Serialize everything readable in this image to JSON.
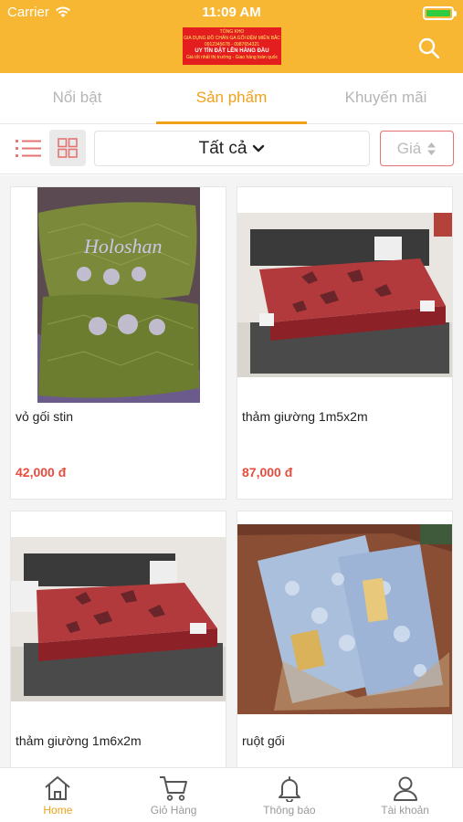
{
  "status_bar": {
    "carrier": "Carrier",
    "time": "11:09 AM",
    "battery_level": 1.0
  },
  "header": {
    "logo_lines": [
      "TỔNG KHO",
      "GIA DỤNG ĐỒ CHĂN GA GỐI ĐỆM MIỀN BẮC",
      "0912345678 - 0987654321",
      "UY TÍN ĐẶT LÊN HÀNG ĐẦU",
      "Giá tốt nhất thị trường - Giao hàng toàn quốc"
    ],
    "search_icon": "search-icon"
  },
  "tabs": [
    {
      "label": "Nổi bật",
      "active": false
    },
    {
      "label": "Sản phẩm",
      "active": true
    },
    {
      "label": "Khuyến mãi",
      "active": false
    }
  ],
  "filter": {
    "category": "Tất cả",
    "price_sort": "Giá"
  },
  "products": [
    {
      "name": "vỏ gối stin",
      "price": "42,000 đ",
      "image": "green-embroidered-pillowcases"
    },
    {
      "name": "thảm giường 1m5x2m",
      "price": "87,000 đ",
      "image": "red-quilted-bed-mat"
    },
    {
      "name": "thảm giường 1m6x2m",
      "price": "",
      "image": "red-quilted-bed-mat"
    },
    {
      "name": "ruột gối",
      "price": "",
      "image": "packaged-pillow-inserts"
    }
  ],
  "bottom_nav": [
    {
      "label": "Home",
      "icon": "home-icon",
      "active": true
    },
    {
      "label": "Giỏ Hàng",
      "icon": "cart-icon",
      "active": false
    },
    {
      "label": "Thông báo",
      "icon": "bell-icon",
      "active": false
    },
    {
      "label": "Tài khoản",
      "icon": "user-icon",
      "active": false
    }
  ],
  "colors": {
    "header": "#f7b733",
    "accent": "#f0a11b",
    "price": "#e74c3c"
  }
}
